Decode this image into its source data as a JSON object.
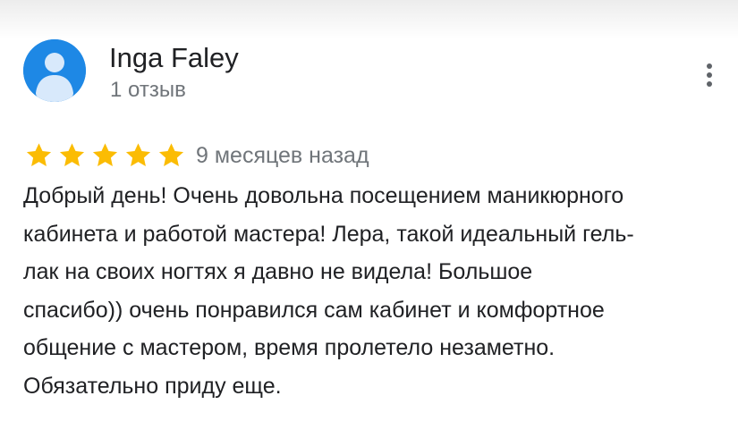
{
  "reviewer": {
    "name": "Inga Faley",
    "review_count": "1 отзыв",
    "avatar_icon": "person-avatar-icon",
    "avatar_color": "#1e88e5"
  },
  "menu": {
    "icon": "more-vert-icon"
  },
  "rating": {
    "value": 5,
    "max": 5,
    "star_color": "#fbbc04",
    "time_ago": "9 месяцев назад"
  },
  "review": {
    "lines": [
      "Добрый день! Очень довольна посещением маникюрного",
      "кабинета и работой мастера! Лера, такой идеальный гель-",
      "лак на своих ногтях я давно не видела! Большое",
      "спасибо)) очень понравился сам кабинет и комфортное",
      "общение с мастером, время пролетело незаметно.",
      "Обязательно приду еще."
    ]
  }
}
